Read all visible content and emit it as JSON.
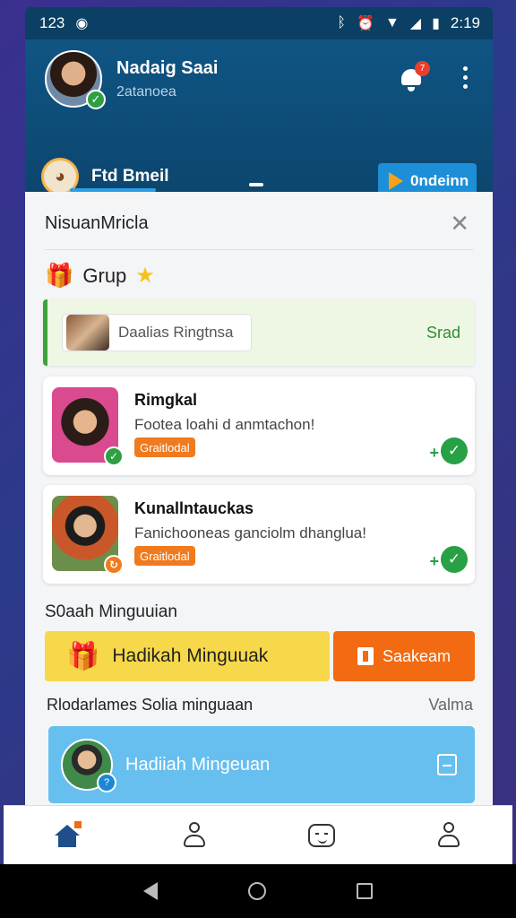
{
  "status_bar": {
    "left_badge": "1⁠23",
    "time": "2:19"
  },
  "header": {
    "user_name": "Nadaig Saai",
    "user_subtitle": "2atanoea",
    "notification_count": "7",
    "secondary_label": "Ftd Bmeil",
    "action_button": "0ndeinn"
  },
  "sheet": {
    "title": "NisuanMricla",
    "group_label": "Grup",
    "banner": {
      "pill_text": "Daalias Ringtnsa",
      "action": "Srad"
    },
    "cards": [
      {
        "name": "Rimgkal",
        "description": "Footea loahi d anmtachon!",
        "tag": "Graitlodal"
      },
      {
        "name": "Kunallntauckas",
        "description": "Fanichooneas ganciolm dhanglua!",
        "tag": "Graitlodal"
      }
    ],
    "weekly_section_label": "S0aah Minguuian",
    "weekly_main_label": "Hadikah  Minguuak",
    "weekly_button_label": "Saakeam",
    "recent_label": "Rlodarlames Solia minguaan",
    "recent_link": "Valma",
    "recent_card_label": "Hadiiah Mingeuan"
  },
  "colors": {
    "header": "#0f5584",
    "accent_green": "#27a046",
    "accent_orange": "#f26a12",
    "weekly_yellow": "#f6d84a",
    "recent_blue": "#67bfef"
  }
}
